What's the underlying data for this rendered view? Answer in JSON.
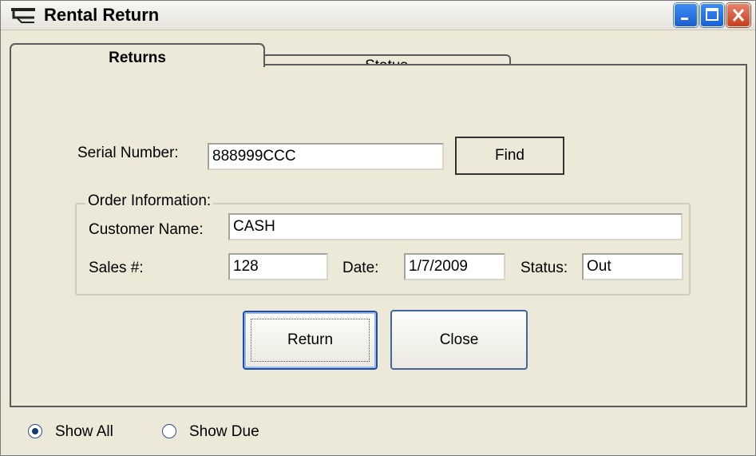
{
  "window": {
    "title": "Rental Return",
    "controls": [
      "minimize-icon",
      "maximize-icon",
      "close-icon"
    ]
  },
  "tabs": [
    {
      "label": "Returns",
      "active": true
    },
    {
      "label": "Status",
      "active": false
    }
  ],
  "search": {
    "serial_label": "Serial Number:",
    "serial_value": "888999CCC",
    "find_label": "Find"
  },
  "order": {
    "legend": "Order Information:",
    "customer_label": "Customer Name:",
    "customer_value": "CASH",
    "sales_label": "Sales #:",
    "sales_value": "128",
    "date_label": "Date:",
    "date_value": "1/7/2009",
    "status_label": "Status:",
    "status_value": "Out"
  },
  "actions": {
    "return_label": "Return",
    "close_label": "Close"
  },
  "filter": {
    "options": [
      {
        "label": "Show All",
        "selected": true
      },
      {
        "label": "Show Due",
        "selected": false
      }
    ]
  },
  "colors": {
    "window_bg": "#ece9d8",
    "close_button": "#c83d1b",
    "title_button": "#1b5fd3"
  }
}
